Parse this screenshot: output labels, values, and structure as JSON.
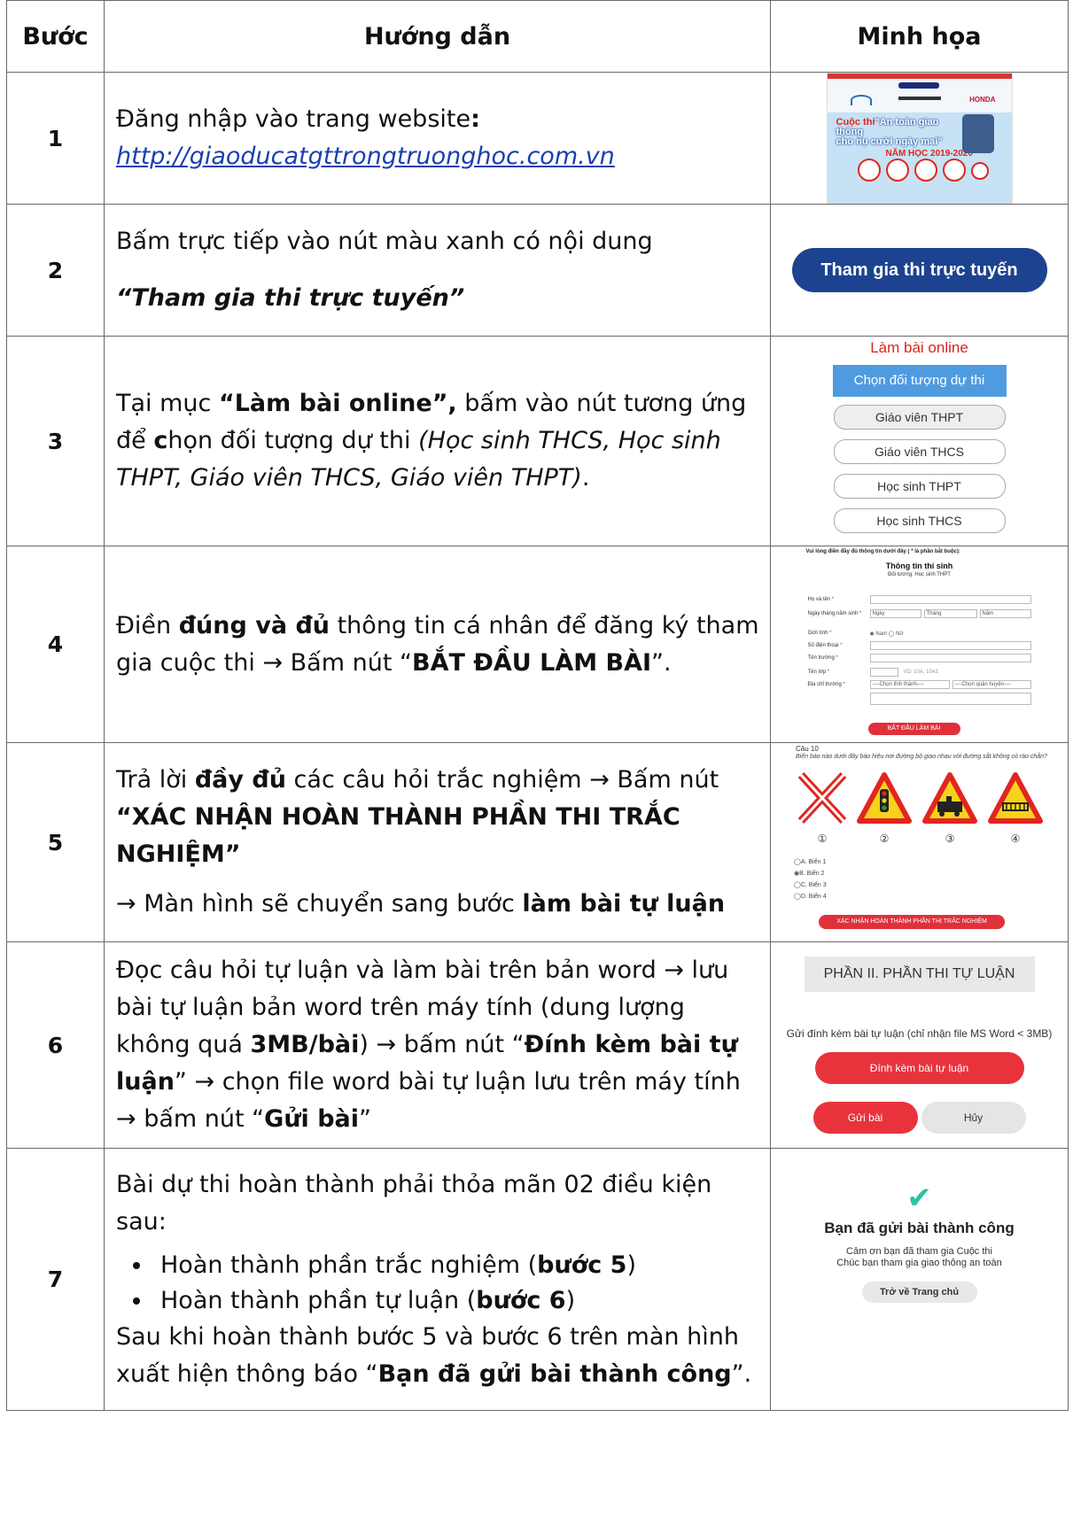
{
  "header": {
    "step": "Bước",
    "guide": "Hướng dẫn",
    "illustration": "Minh họa"
  },
  "colors": {
    "link": "#1a3fb0",
    "primary_button": "#1d4390",
    "red": "#d9261c",
    "success": "#2cc4a0"
  },
  "rows": [
    {
      "num": "1",
      "t1": "Đăng nhập vào trang website",
      "t2": ":",
      "link": "http://giaoducatgttrongtruonghoc.com.vn",
      "banner": {
        "c1": "Cuộc thi",
        "c2": "\"An toàn giao thông",
        "c3": "cho nụ cười ngày mai\"",
        "year": "NĂM HỌC 2019-2020",
        "honda": "HONDA"
      }
    },
    {
      "num": "2",
      "t1": "Bấm trực tiếp vào nút màu xanh có nội dung",
      "t2": "“Tham gia thi trực tuyến”",
      "button": "Tham gia thi trực tuyến"
    },
    {
      "num": "3",
      "t1": "Tại mục ",
      "t2": "“Làm bài online”,",
      "t3": " bấm vào nút tương ứng để ",
      "t4": "c",
      "t5": "họn đối tượng dự thi ",
      "t6": "(Học sinh THCS, Học sinh THPT, Giáo viên THCS, Giáo viên THPT)",
      "t7": ".",
      "title": "Làm bài online",
      "choose": "Chọn đối tượng dự thi",
      "options": [
        "Giáo viên THPT",
        "Giáo viên THCS",
        "Học sinh THPT",
        "Học sinh THCS"
      ]
    },
    {
      "num": "4",
      "t1": "Điền ",
      "t2": "đúng và đủ",
      "t3": " thông tin cá nhân để đăng ký tham gia cuộc thi → Bấm nút  “",
      "t4": "BẮT ĐẦU LÀM BÀI",
      "t5": "”.",
      "form": {
        "intro": "Vui lòng điền đầy đủ thông tin dưới đây ( * là phần bắt buộc):",
        "title": "Thông tin thí sinh",
        "subtitle": "Đối tượng: Học sinh THPT",
        "l1": "Họ và tên",
        "l2": "Ngày tháng năm sinh",
        "l3": "Giới tính",
        "l4": "Số điện thoại",
        "l5": "Tên trường",
        "l6": "Tên lớp",
        "l7": "Địa chỉ trường",
        "day": "Ngày",
        "month": "Tháng",
        "year": "Năm",
        "gender": "◉ Nam ◯ Nữ",
        "class_ph": "VD: 10A, 10A1",
        "province": "----Chọn tỉnh thành----",
        "district": "----Chọn quận huyện----",
        "start": "BẮT ĐẦU LÀM BÀI"
      }
    },
    {
      "num": "5",
      "t1": "Trả lời ",
      "t2": "đầy đủ",
      "t3": " các câu hỏi trắc nghiệm → Bấm nút ",
      "t4": "“XÁC NHẬN HOÀN THÀNH PHẦN THI TRẮC NGHIỆM”",
      "t5": "→ Màn hình sẽ chuyển sang bước ",
      "t6": "làm bài tự luận",
      "quiz": {
        "title": "Câu 10",
        "question": "Biển báo nào dưới đây báo hiệu nơi đường bộ giao nhau với đường sắt không có rào chắn?",
        "nums": [
          "①",
          "②",
          "③",
          "④"
        ],
        "answers": [
          "◯A. Biển 1",
          "◉B. Biển 2",
          "◯C. Biển 3",
          "◯D. Biển 4"
        ],
        "confirm": "XÁC NHẬN HOÀN THÀNH PHẦN THI TRẮC NGHIỆM"
      }
    },
    {
      "num": "6",
      "t1": "Đọc câu hỏi tự luận và làm bài trên bản word → lưu bài tự luận bản word trên máy tính (dung lượng không quá ",
      "t2": "3MB/bài",
      "t3": ") → bấm nút “",
      "t4": "Đính kèm bài tự luận",
      "t5": "” → chọn file word bài tự luận lưu trên máy tính → bấm nút “",
      "t6": "Gửi bài",
      "t7": "”",
      "essay": {
        "title": "PHẦN II. PHẦN THI TỰ LUẬN",
        "note": "Gửi đính kèm bài tự luận (chỉ nhận file MS Word < 3MB)",
        "attach": "Đính kèm bài tự luận",
        "send": "Gửi bài",
        "cancel": "Hủy"
      }
    },
    {
      "num": "7",
      "t1": "Bài dự thi hoàn thành phải thỏa mãn 02 điều kiện sau:",
      "li1a": "Hoàn thành phần trắc nghiệm (",
      "li1b": "bước 5",
      "li1c": ")",
      "li2a": "Hoàn thành phần tự luận (",
      "li2b": "bước 6",
      "li2c": ")",
      "t2": "Sau khi hoàn thành bước 5 và bước 6 trên màn hình xuất hiện thông báo “",
      "t3": "Bạn đã gửi bài thành công",
      "t4": "”.",
      "success": {
        "check": "✔",
        "title": "Bạn đã gửi bài thành công",
        "msg1": "Cảm ơn bạn đã tham gia Cuộc thi",
        "msg2": "Chúc bạn tham gia giao thông an toàn",
        "home": "Trở về Trang chủ"
      }
    }
  ]
}
